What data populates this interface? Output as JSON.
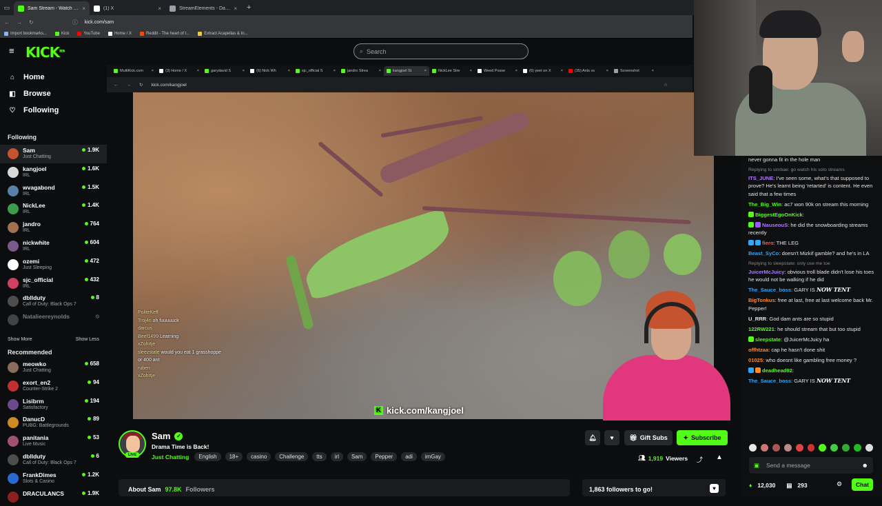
{
  "browser": {
    "tabs": [
      {
        "label": "Sam Stream - Watch Live on Ki",
        "color": "#53fc18",
        "active": true
      },
      {
        "label": "(1) X",
        "color": "#ffffff",
        "active": false
      },
      {
        "label": "StreamElements - Dashboard",
        "color": "#9aa0a6",
        "active": false
      }
    ],
    "new_tab": "+",
    "url": "kick.com/sam",
    "bookmarks": [
      {
        "label": "Import bookmarks...",
        "color": "#8ab4f8"
      },
      {
        "label": "Kick",
        "color": "#53fc18"
      },
      {
        "label": "YouTube",
        "color": "#ff0000"
      },
      {
        "label": "Home / X",
        "color": "#ffffff"
      },
      {
        "label": "Reddit - The heart of t...",
        "color": "#ff4500"
      },
      {
        "label": "Extract Acapellas & In...",
        "color": "#f5c542"
      }
    ]
  },
  "header": {
    "logo": "KICK",
    "logo_sup": "BETA",
    "search_placeholder": "Search"
  },
  "sidebar": {
    "nav": [
      {
        "label": "Home",
        "icon": "home-icon",
        "glyph": "⌂"
      },
      {
        "label": "Browse",
        "icon": "browse-icon",
        "glyph": "◧"
      },
      {
        "label": "Following",
        "icon": "heart-icon",
        "glyph": "♡"
      }
    ],
    "following_title": "Following",
    "following": [
      {
        "name": "Sam",
        "category": "Just Chatting",
        "viewers": "1.9K",
        "color": "#c5532d",
        "selected": true
      },
      {
        "name": "kangjoel",
        "category": "IRL",
        "viewers": "1.6K",
        "color": "#d8d8d8"
      },
      {
        "name": "wvagabond",
        "category": "IRL",
        "viewers": "1.5K",
        "color": "#5a7fa8"
      },
      {
        "name": "NickLee",
        "category": "IRL",
        "viewers": "1.4K",
        "color": "#3b9d4b"
      },
      {
        "name": "jandro",
        "category": "IRL",
        "viewers": "764",
        "color": "#a07050"
      },
      {
        "name": "nickwhite",
        "category": "IRL",
        "viewers": "604",
        "color": "#7a5a8a"
      },
      {
        "name": "ozemi",
        "category": "Just Sleeping",
        "viewers": "472",
        "color": "#ffffff"
      },
      {
        "name": "sjc_official",
        "category": "IRL",
        "viewers": "432",
        "color": "#d04060"
      },
      {
        "name": "dbllduty",
        "category": "Call of Duty: Black Ops 7",
        "viewers": "8",
        "color": "#4d4d4d"
      },
      {
        "name": "Natalieereynolds",
        "category": "",
        "viewers": "",
        "color": "#777777",
        "offline": true
      }
    ],
    "show_more": "Show More",
    "show_less": "Show Less",
    "recommended_title": "Recommended",
    "recommended": [
      {
        "name": "meowko",
        "category": "Just Chatting",
        "viewers": "658",
        "color": "#8a6a5a"
      },
      {
        "name": "exort_en2",
        "category": "Counter-Strike 2",
        "viewers": "94",
        "color": "#c03030"
      },
      {
        "name": "Lisibrm",
        "category": "Satisfactory",
        "viewers": "194",
        "color": "#6a4a8a"
      },
      {
        "name": "DanucD",
        "category": "PUBG: Battlegrounds",
        "viewers": "89",
        "color": "#d08a20"
      },
      {
        "name": "panitania",
        "category": "Live Music",
        "viewers": "53",
        "color": "#a05070"
      },
      {
        "name": "dbllduty",
        "category": "Call of Duty: Black Ops 7",
        "viewers": "6",
        "color": "#4d4d4d"
      },
      {
        "name": "FrankDimes",
        "category": "Slots & Casino",
        "viewers": "1.2K",
        "color": "#2a6ad0"
      },
      {
        "name": "DRACULANCS",
        "category": "",
        "viewers": "1.9K",
        "color": "#8a2020"
      }
    ]
  },
  "inner_browser": {
    "tabs": [
      {
        "label": "MultiKick.com",
        "color": "#53fc18"
      },
      {
        "label": "(3) Home / X",
        "color": "#ffffff"
      },
      {
        "label": "garydavid S",
        "color": "#53fc18"
      },
      {
        "label": "(6) Nick Wh",
        "color": "#ffffff"
      },
      {
        "label": "sjc_official S",
        "color": "#53fc18"
      },
      {
        "label": "jandro Strea",
        "color": "#53fc18"
      },
      {
        "label": "kangjoel St",
        "color": "#53fc18",
        "active": true
      },
      {
        "label": "NickLee Stre",
        "color": "#53fc18"
      },
      {
        "label": "Weed Posse",
        "color": "#ffffff"
      },
      {
        "label": "(6) yeet on X",
        "color": "#ffffff"
      },
      {
        "label": "(35) Ants vs",
        "color": "#ff0000"
      },
      {
        "label": "Screenshot",
        "color": "#9aa0a6"
      }
    ],
    "url": "kick.com/kangjoel"
  },
  "video": {
    "watermark": "kick.com/kangjoel",
    "overlay_chat": [
      {
        "user": "PoliteKeff",
        "text": ""
      },
      {
        "user": "Troj4n",
        "text": "oh fuuuuuck"
      },
      {
        "user": "darcus",
        "text": ""
      },
      {
        "user": "Beef1499",
        "text": "Learning"
      },
      {
        "user": "xZohrtje",
        "text": ""
      },
      {
        "user": "sleezstate",
        "text": "would you eat 1 grasshoppe"
      },
      {
        "user": "",
        "text": "or 400 ant"
      },
      {
        "user": "ruben",
        "text": ""
      },
      {
        "user": "xZohrtje",
        "text": ""
      }
    ]
  },
  "stream_info": {
    "streamer": "Sam",
    "live": "LIVE",
    "title": "Drama Time is Back!",
    "category": "Just Chatting",
    "tags": [
      "English",
      "18+",
      "casino",
      "Challenge",
      "tts",
      "irl",
      "Sam",
      "Pepper",
      "adi",
      "imGay"
    ],
    "gift_subs": "Gift Subs",
    "subscribe": "Subscribe",
    "viewers_count": "1,919",
    "viewers_label": "Viewers",
    "about_label": "About Sam",
    "followers_count": "97.8K",
    "followers_label": "Followers",
    "goal_text": "1,863 followers to go!"
  },
  "chat": {
    "messages": [
      {
        "user": "",
        "text": "never gonna fit in the hole man",
        "color": "#e6e6e6"
      },
      {
        "reply": "Replying to simbae: go watch his solo streams",
        "user": "ITS_JUNE",
        "text": "I've seen some, what's that supposed to prove? He's learnt being 'retarted' is content. He even said that a few times",
        "color": "#b07aff"
      },
      {
        "user": "The_Big_Win",
        "text": "ac7 won 90k on stream this morning",
        "color": "#53fc18"
      },
      {
        "user": "BiggestEgoOnKick",
        "text": "",
        "color": "#53fc18",
        "badges": [
          "#53fc18"
        ]
      },
      {
        "user": "NauseouS",
        "text": "he did the snowboarding streams recently",
        "color": "#b07aff",
        "badges": [
          "#53fc18",
          "#9b59ff"
        ]
      },
      {
        "user": "fiero",
        "text": "THE LEG",
        "color": "#ff5a5a",
        "badges": [
          "#2ea7ff",
          "#2ea7ff"
        ]
      },
      {
        "user": "Beast_SyCo",
        "text": "doesn't Mizkif gamble? and he's in LA",
        "color": "#2ea7ff"
      },
      {
        "reply": "Replying to sleepstate: only use me toe",
        "user": "JuicerMcJuicy",
        "text": "obvious troll blade didn't lose his toes he would not be walking if he did",
        "color": "#b07aff"
      },
      {
        "user": "The_Sauce_boss",
        "text": "GARY IS",
        "emote": "NOW TENT",
        "color": "#2ea7ff"
      },
      {
        "user": "BigTonkus",
        "text": "free at last, free at last welcome back Mr. Pepper!",
        "color": "#ff8a2a"
      },
      {
        "user": "U_RRR",
        "text": "God dam ants are so stupid",
        "color": "#e6e6e6"
      },
      {
        "user": "122RW221",
        "text": "he should stream that but too stupid",
        "color": "#53fc18"
      },
      {
        "user": "sleepstate",
        "text": "@JuicerMcJuicy ha",
        "color": "#53fc18",
        "badges": [
          "#53fc18"
        ]
      },
      {
        "user": "offhtzaa",
        "text": "cap he hasn't done shit",
        "color": "#ff8a2a"
      },
      {
        "user": "01025",
        "text": "who doesnt like gambling free money ?",
        "color": "#ff8a2a"
      },
      {
        "user": "deadhead92",
        "text": "",
        "color": "#53fc18",
        "badges": [
          "#2ea7ff",
          "#ff8a2a"
        ]
      },
      {
        "user": "The_Sauce_boss",
        "text": "GARY IS",
        "emote": "NOW TENT",
        "color": "#2ea7ff"
      }
    ],
    "input_placeholder": "Send a message",
    "kicks": "12,030",
    "subs_count": "293",
    "chat_button": "Chat"
  }
}
